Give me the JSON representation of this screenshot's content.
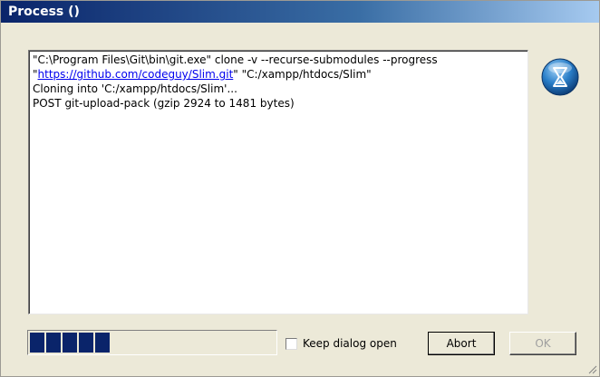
{
  "window": {
    "title": "Process ()"
  },
  "log": {
    "line1": "\"C:\\Program Files\\Git\\bin\\git.exe\" clone -v --recurse-submodules --progress",
    "line2_quote_open": "\"",
    "line2_link": "https://github.com/codeguy/Slim.git",
    "line2_rest": "\" \"C:/xampp/htdocs/Slim\"",
    "line3": "Cloning into 'C:/xampp/htdocs/Slim'...",
    "line4": "POST git-upload-pack (gzip 2924 to 1481 bytes)"
  },
  "progress": {
    "segments_filled": 5
  },
  "options": {
    "keep_open_label": "Keep dialog open",
    "keep_open_checked": false
  },
  "buttons": {
    "abort_label": "Abort",
    "ok_label": "OK"
  },
  "icons": {
    "busy": "hourglass-icon"
  },
  "colors": {
    "title_bar_start": "#0a246a",
    "progress_fill": "#0a246a",
    "link": "#0000ee"
  }
}
